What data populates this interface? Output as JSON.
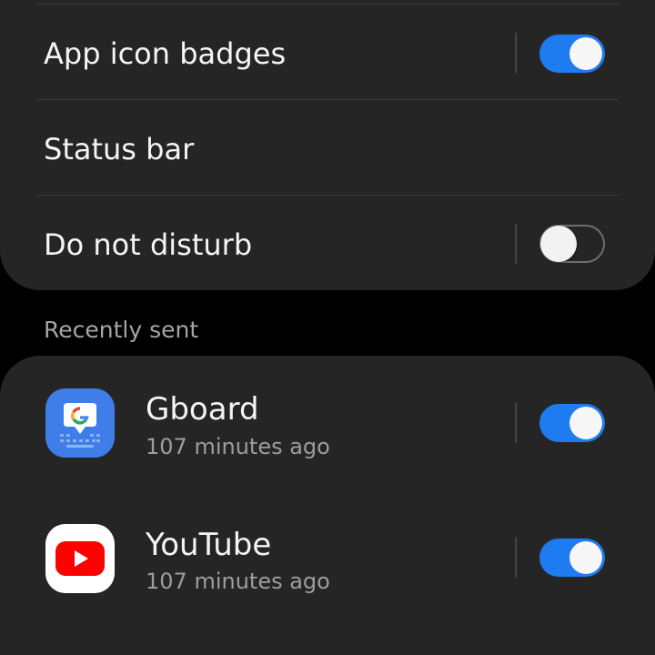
{
  "settings": {
    "items": [
      {
        "label": "App icon badges",
        "toggle": true
      },
      {
        "label": "Status bar"
      },
      {
        "label": "Do not disturb",
        "toggle": false
      }
    ]
  },
  "recently_sent": {
    "header": "Recently sent",
    "apps": [
      {
        "name": "Gboard",
        "time": "107 minutes ago",
        "icon": "gboard-icon",
        "enabled": true
      },
      {
        "name": "YouTube",
        "time": "107 minutes ago",
        "icon": "youtube-icon",
        "enabled": true
      }
    ]
  },
  "colors": {
    "background": "#000000",
    "card": "#252525",
    "toggle_on": "#1e7cf0",
    "text_primary": "#f5f5f5",
    "text_secondary": "#9d9d9d"
  }
}
